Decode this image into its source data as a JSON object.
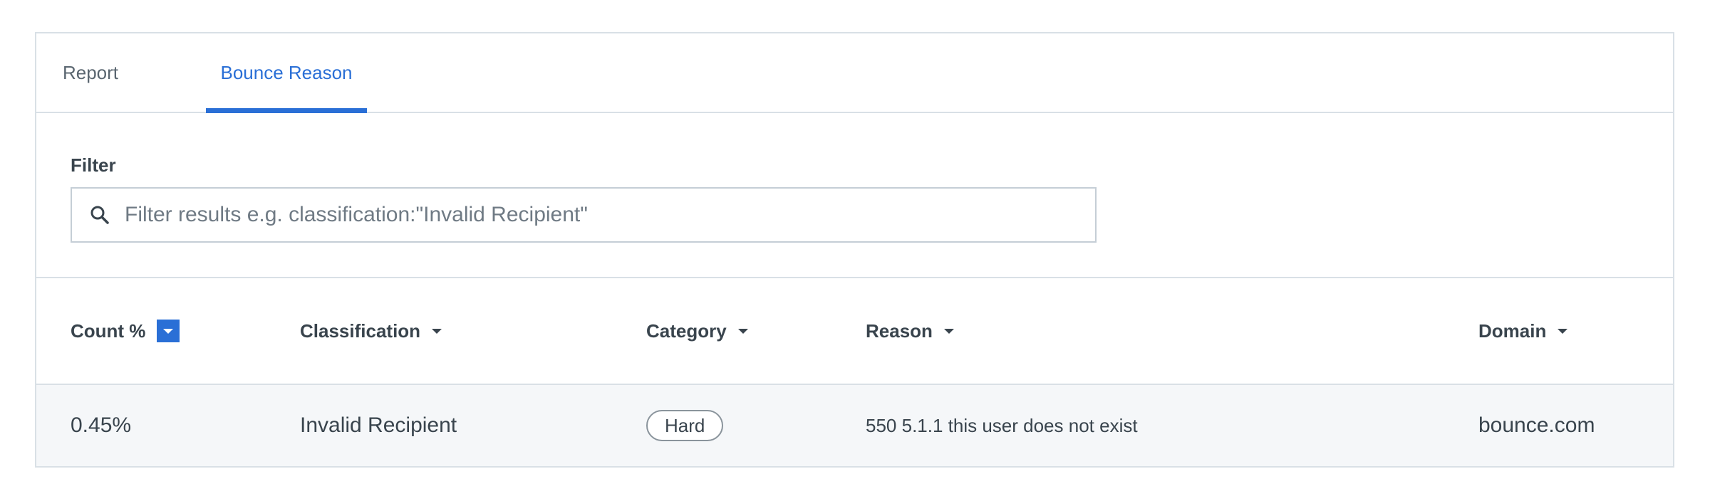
{
  "tabs": [
    {
      "label": "Report",
      "active": false
    },
    {
      "label": "Bounce Reason",
      "active": true
    }
  ],
  "filter": {
    "label": "Filter",
    "placeholder": "Filter results e.g. classification:\"Invalid Recipient\"",
    "value": ""
  },
  "table": {
    "columns": [
      {
        "label": "Count %",
        "sorted": true
      },
      {
        "label": "Classification",
        "sorted": false
      },
      {
        "label": "Category",
        "sorted": false
      },
      {
        "label": "Reason",
        "sorted": false
      },
      {
        "label": "Domain",
        "sorted": false
      }
    ],
    "rows": [
      {
        "count_pct": "0.45%",
        "classification": "Invalid Recipient",
        "category": "Hard",
        "reason": "550 5.1.1 this user does not exist",
        "domain": "bounce.com"
      }
    ]
  },
  "colors": {
    "accent": "#2a6fd6",
    "text": "#39444d",
    "border": "#d9e0e6",
    "row_bg": "#f5f7f9"
  },
  "icons": {
    "search": "search-icon",
    "sort_active": "sort-desc-icon",
    "sort_inactive": "chevron-down-icon"
  }
}
